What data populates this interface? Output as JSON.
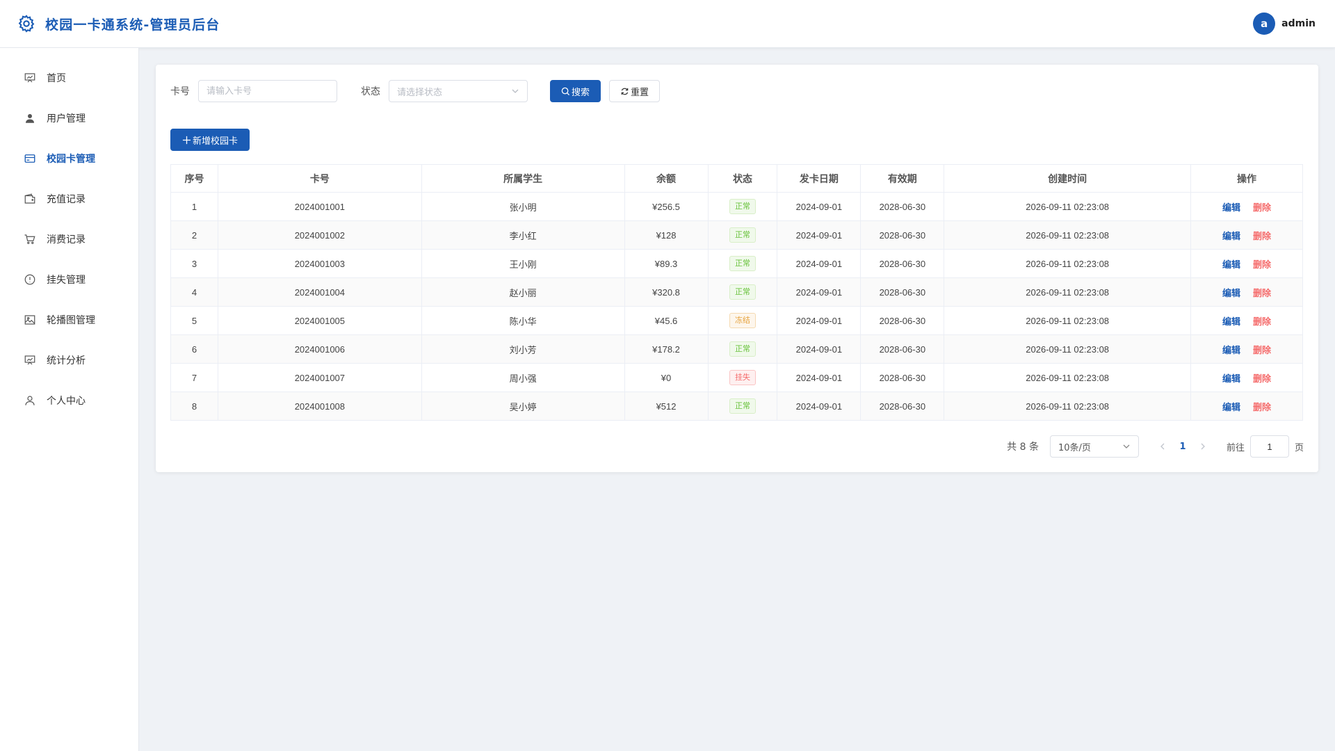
{
  "header": {
    "title": "校园一卡通系统-管理员后台",
    "avatar_letter": "a",
    "username": "admin"
  },
  "sidebar": {
    "items": [
      {
        "label": "首页",
        "icon": "chart-board-icon"
      },
      {
        "label": "用户管理",
        "icon": "user-filled-icon"
      },
      {
        "label": "校园卡管理",
        "icon": "credit-card-icon",
        "active": true
      },
      {
        "label": "充值记录",
        "icon": "wallet-icon"
      },
      {
        "label": "消费记录",
        "icon": "cart-icon"
      },
      {
        "label": "挂失管理",
        "icon": "warning-circle-icon"
      },
      {
        "label": "轮播图管理",
        "icon": "picture-icon"
      },
      {
        "label": "统计分析",
        "icon": "chart-board-icon"
      },
      {
        "label": "个人中心",
        "icon": "user-outline-icon"
      }
    ]
  },
  "filters": {
    "card_label": "卡号",
    "card_placeholder": "请输入卡号",
    "status_label": "状态",
    "status_placeholder": "请选择状态",
    "search_label": "搜索",
    "reset_label": "重置"
  },
  "add_button": "新增校园卡",
  "table": {
    "headers": [
      "序号",
      "卡号",
      "所属学生",
      "余额",
      "状态",
      "发卡日期",
      "有效期",
      "创建时间",
      "操作"
    ],
    "rows": [
      {
        "no": "1",
        "card": "2024001001",
        "student": "张小明",
        "balance": "¥256.5",
        "status": "正常",
        "issue": "2024-09-01",
        "expire": "2028-06-30",
        "created": "2026-09-11 02:23:08"
      },
      {
        "no": "2",
        "card": "2024001002",
        "student": "李小红",
        "balance": "¥128",
        "status": "正常",
        "issue": "2024-09-01",
        "expire": "2028-06-30",
        "created": "2026-09-11 02:23:08"
      },
      {
        "no": "3",
        "card": "2024001003",
        "student": "王小刚",
        "balance": "¥89.3",
        "status": "正常",
        "issue": "2024-09-01",
        "expire": "2028-06-30",
        "created": "2026-09-11 02:23:08"
      },
      {
        "no": "4",
        "card": "2024001004",
        "student": "赵小丽",
        "balance": "¥320.8",
        "status": "正常",
        "issue": "2024-09-01",
        "expire": "2028-06-30",
        "created": "2026-09-11 02:23:08"
      },
      {
        "no": "5",
        "card": "2024001005",
        "student": "陈小华",
        "balance": "¥45.6",
        "status": "冻结",
        "issue": "2024-09-01",
        "expire": "2028-06-30",
        "created": "2026-09-11 02:23:08"
      },
      {
        "no": "6",
        "card": "2024001006",
        "student": "刘小芳",
        "balance": "¥178.2",
        "status": "正常",
        "issue": "2024-09-01",
        "expire": "2028-06-30",
        "created": "2026-09-11 02:23:08"
      },
      {
        "no": "7",
        "card": "2024001007",
        "student": "周小强",
        "balance": "¥0",
        "status": "挂失",
        "issue": "2024-09-01",
        "expire": "2028-06-30",
        "created": "2026-09-11 02:23:08"
      },
      {
        "no": "8",
        "card": "2024001008",
        "student": "吴小婷",
        "balance": "¥512",
        "status": "正常",
        "issue": "2024-09-01",
        "expire": "2028-06-30",
        "created": "2026-09-11 02:23:08"
      }
    ],
    "edit_label": "编辑",
    "delete_label": "删除"
  },
  "status_colors": {
    "正常": {
      "text": "#67c23a",
      "bg": "#f0f9eb",
      "border": "#d9efc8"
    },
    "冻结": {
      "text": "#e6a23c",
      "bg": "#fdf6ec",
      "border": "#f5dab1"
    },
    "挂失": {
      "text": "#f56c6c",
      "bg": "#fef0f0",
      "border": "#fbc4c4"
    }
  },
  "pagination": {
    "total_text": "共 8 条",
    "page_size": "10条/页",
    "current_page": "1",
    "goto_label": "前往",
    "goto_value": "1",
    "goto_suffix": "页"
  },
  "colors": {
    "primary": "#1b5cb5",
    "danger": "#f56c6c"
  }
}
